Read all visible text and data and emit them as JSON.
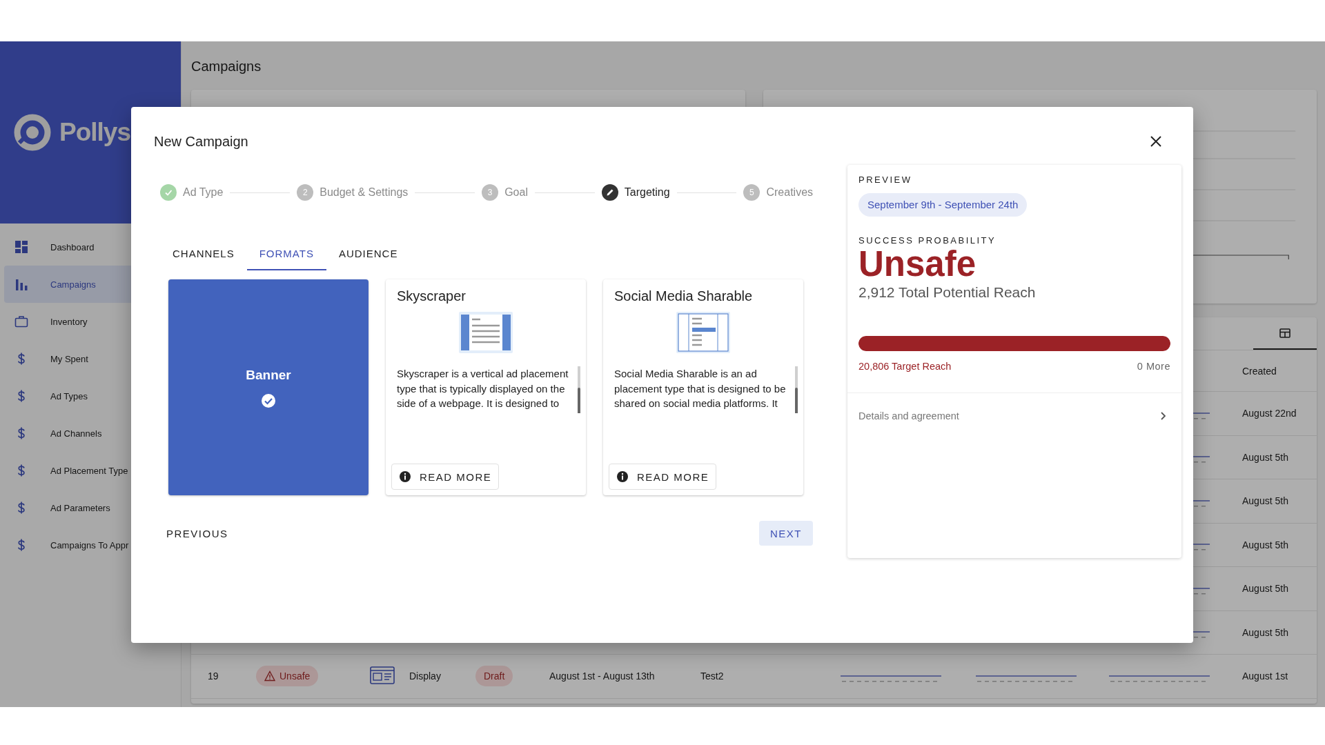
{
  "app": {
    "logo_text": "Pollys",
    "page_title": "Campaigns"
  },
  "sidebar": {
    "items": [
      {
        "label": "Dashboard",
        "kind": "dashboard",
        "selected": false
      },
      {
        "label": "Campaigns",
        "kind": "chart",
        "selected": true
      },
      {
        "label": "Inventory",
        "kind": "briefcase",
        "selected": false
      },
      {
        "label": "My Spent",
        "kind": "dollar",
        "selected": false
      },
      {
        "label": "Ad Types",
        "kind": "dollar",
        "selected": false
      },
      {
        "label": "Ad Channels",
        "kind": "dollar",
        "selected": false
      },
      {
        "label": "Ad Placement Type",
        "kind": "dollar",
        "selected": false
      },
      {
        "label": "Ad Parameters",
        "kind": "dollar",
        "selected": false
      },
      {
        "label": "Campaigns To Appr",
        "kind": "dollar",
        "selected": false
      }
    ]
  },
  "table": {
    "created_header": "Created",
    "rows": [
      {
        "created": "August 22nd"
      },
      {
        "created": "August 5th"
      },
      {
        "created": "August 5th"
      },
      {
        "created": "August 5th"
      },
      {
        "created": "August 5th"
      },
      {
        "created": "August 5th"
      },
      {
        "number": "19",
        "status": "Unsafe",
        "format": "Display",
        "state": "Draft",
        "dates": "August 1st - August 13th",
        "name": "Test2",
        "created": "August 1st"
      }
    ]
  },
  "modal": {
    "title": "New Campaign",
    "steps": [
      {
        "label": "Ad Type",
        "kind": "completed"
      },
      {
        "label": "Budget & Settings",
        "kind": "pending",
        "number": "2"
      },
      {
        "label": "Goal",
        "kind": "pending",
        "number": "3"
      },
      {
        "label": "Targeting",
        "kind": "active"
      },
      {
        "label": "Creatives",
        "kind": "pending",
        "number": "5"
      }
    ],
    "tabs": [
      {
        "label": "CHANNELS",
        "selected": false
      },
      {
        "label": "FORMATS",
        "selected": true
      },
      {
        "label": "AUDIENCE",
        "selected": false
      }
    ],
    "formats": [
      {
        "title": "Banner",
        "selected": true
      },
      {
        "title": "Skyscraper",
        "kind": "skyscraper",
        "selected": false,
        "description": "Skyscraper is a vertical ad placement type that is typically displayed on the side of a webpage. It is designed to",
        "action": "READ MORE"
      },
      {
        "title": "Social Media Sharable",
        "kind": "social",
        "selected": false,
        "description": "Social Media Sharable is an ad placement type that is designed to be shared on social media platforms. It",
        "action": "READ MORE"
      }
    ],
    "previous": "PREVIOUS",
    "next": "NEXT",
    "preview": {
      "label": "PREVIEW",
      "date_range": "September 9th - September 24th",
      "probability_label": "SUCCESS PROBABILITY",
      "probability": "Unsafe",
      "total_reach": "2,912 Total Potential Reach",
      "level": 1,
      "target_reach": "20,806 Target Reach",
      "more": "0 More",
      "details": "Details and agreement"
    }
  }
}
